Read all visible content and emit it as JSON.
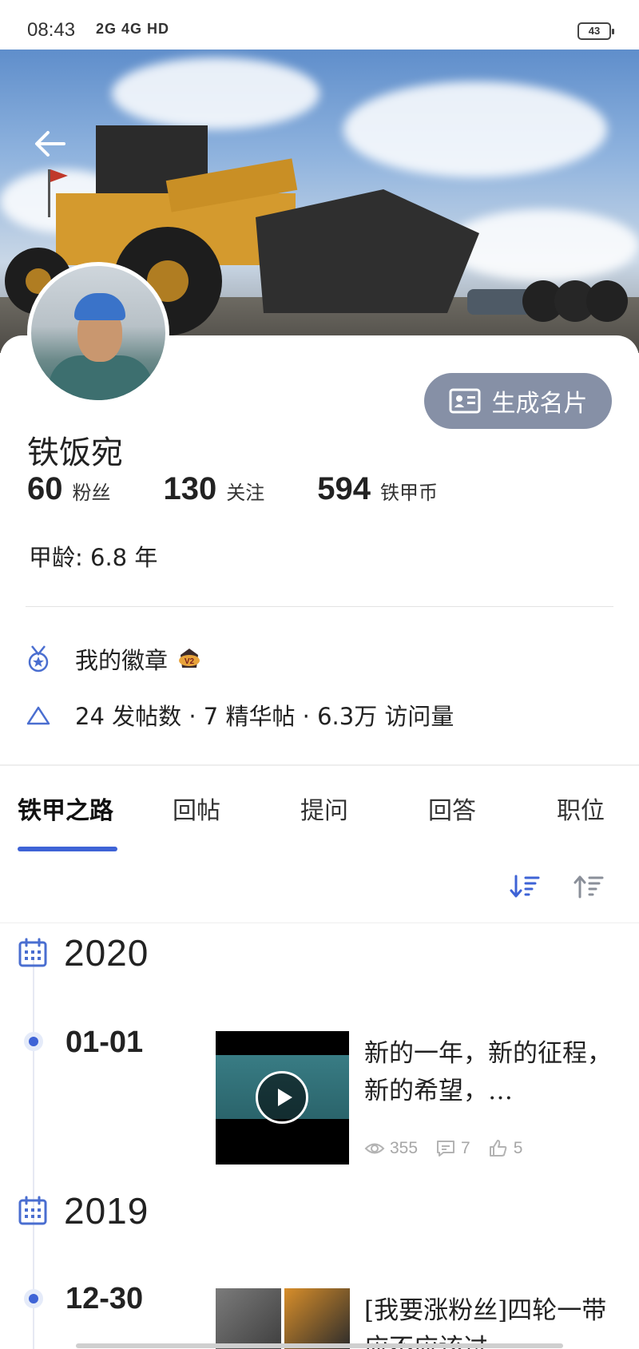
{
  "status_bar": {
    "time": "08:43",
    "network": "2G 4G HD",
    "battery": "43"
  },
  "profile": {
    "name": "铁饭宛",
    "generate_card_label": "生成名片",
    "stats": [
      {
        "value": "60",
        "label": "粉丝"
      },
      {
        "value": "130",
        "label": "关注"
      },
      {
        "value": "594",
        "label": "铁甲币"
      }
    ],
    "age_label": "甲龄: 6.8 年",
    "badge_label": "我的徽章",
    "activity": "24 发帖数 · 7 精华帖 · 6.3万 访问量"
  },
  "tabs": [
    {
      "label": "铁甲之路",
      "active": true
    },
    {
      "label": "回帖",
      "active": false
    },
    {
      "label": "提问",
      "active": false
    },
    {
      "label": "回答",
      "active": false
    },
    {
      "label": "职位",
      "active": false
    }
  ],
  "colors": {
    "accent": "#3e63d6",
    "button_bg": "#8690a6"
  },
  "timeline": [
    {
      "year": "2020",
      "entries": [
        {
          "date": "01-01",
          "title": "新的一年，新的征程，新的希望，…",
          "views": "355",
          "comments": "7",
          "likes": "5",
          "media": "video"
        }
      ]
    },
    {
      "year": "2019",
      "entries": [
        {
          "date": "12-30",
          "title": "[我要涨粉丝]四轮一带应不应该过…",
          "media": "images"
        }
      ]
    }
  ]
}
